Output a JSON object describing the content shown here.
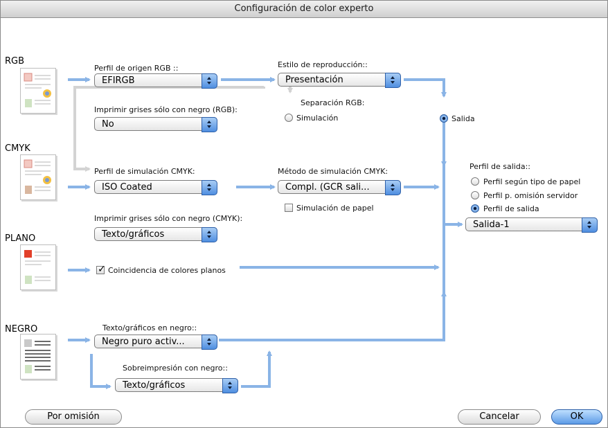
{
  "window": {
    "title": "Configuración de color experto"
  },
  "sections": {
    "rgb": "RGB",
    "cmyk": "CMYK",
    "plano": "PLANO",
    "negro": "NEGRO"
  },
  "rgb": {
    "source_profile_label": "Perfil de origen RGB ::",
    "source_profile_value": "EFIRGB",
    "gray_black_label": "Imprimir grises sólo con negro (RGB):",
    "gray_black_value": "No",
    "render_style_label": "Estilo de reproducción::",
    "render_style_value": "Presentación",
    "separation_label": "Separación RGB:",
    "simulation_radio": "Simulación",
    "output_radio": "Salida"
  },
  "cmyk": {
    "sim_profile_label": "Perfil de simulación CMYK:",
    "sim_profile_value": "ISO Coated",
    "sim_method_label": "Método de simulación CMYK:",
    "sim_method_value": "Compl. (GCR sali...",
    "paper_sim_label": "Simulación de papel",
    "gray_black_label": "Imprimir grises sólo con negro (CMYK):",
    "gray_black_value": "Texto/gráficos"
  },
  "plano": {
    "spot_match_label": "Coincidencia de colores planos"
  },
  "negro": {
    "text_black_label": "Texto/gráficos en negro::",
    "text_black_value": "Negro puro activ...",
    "overprint_label": "Sobreimpresión con negro::",
    "overprint_value": "Texto/gráficos"
  },
  "output": {
    "profile_label": "Perfil de salida::",
    "option_paper": "Perfil según tipo de papel",
    "option_server": "Perfil p. omisión servidor",
    "option_output": "Perfil de salida",
    "profile_value": "Salida-1"
  },
  "buttons": {
    "default": "Por omisión",
    "cancel": "Cancelar",
    "ok": "OK"
  },
  "colors": {
    "arrow": "#8ab4e6",
    "gray_line": "#d3d3d3",
    "accent": "#5c9ae6"
  }
}
